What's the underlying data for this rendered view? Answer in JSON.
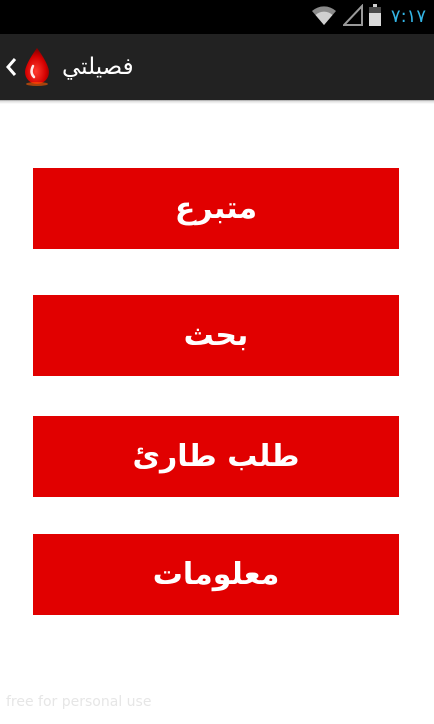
{
  "status_bar": {
    "time": "٧:١٧",
    "icons": [
      "wifi-icon",
      "signal-icon",
      "battery-icon"
    ]
  },
  "action_bar": {
    "title": "فصيلتي",
    "logo": "blood-drop-icon",
    "up_icon": "chevron-left-icon"
  },
  "menu": {
    "items": [
      {
        "label": "متبرع"
      },
      {
        "label": "بحث"
      },
      {
        "label": "طلب طارئ"
      },
      {
        "label": "معلومات"
      }
    ]
  },
  "watermark": "free for personal use",
  "colors": {
    "accent": "#e10000",
    "action_bar": "#222222",
    "status_bar": "#000000",
    "time": "#33b5e5"
  }
}
